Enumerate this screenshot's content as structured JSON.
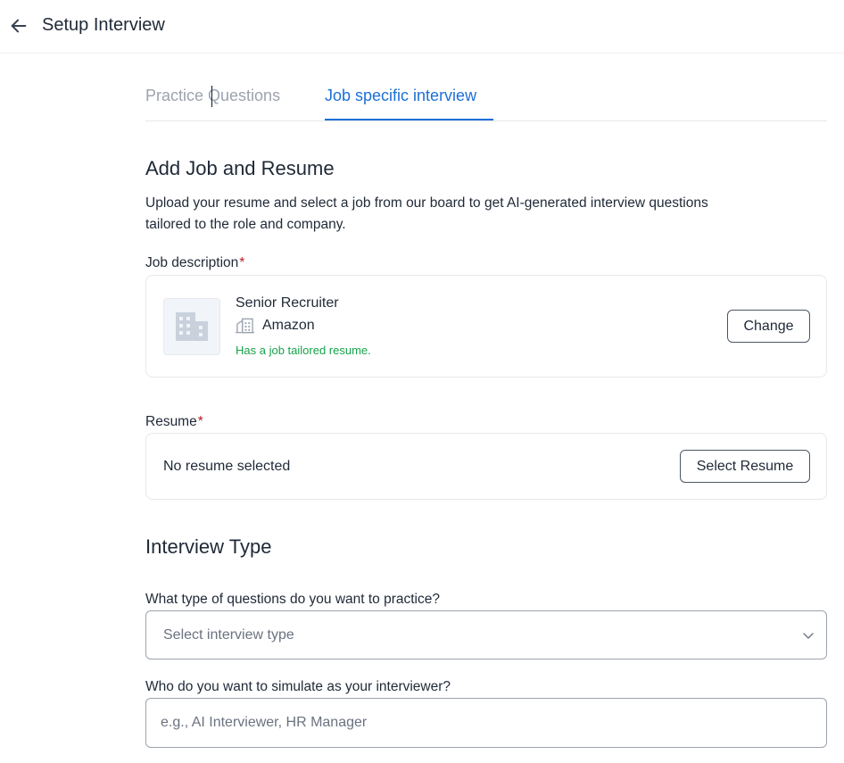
{
  "header": {
    "title": "Setup Interview",
    "back_icon": "arrow-left-icon"
  },
  "tabs": [
    {
      "label": "Practice Questions",
      "active": false
    },
    {
      "label": "Job specific interview",
      "active": true
    }
  ],
  "job_resume": {
    "title": "Add Job and Resume",
    "description": "Upload your resume and select a job from our board to get AI-generated interview questions tailored to the role and company.",
    "job_label": "Job description",
    "required_mark": "*",
    "job": {
      "title": "Senior Recruiter",
      "company": "Amazon",
      "status": "Has a job tailored resume.",
      "change_label": "Change"
    },
    "resume_label": "Resume",
    "resume": {
      "empty_text": "No resume selected",
      "select_label": "Select Resume"
    }
  },
  "interview_type": {
    "title": "Interview Type",
    "question_label": "What type of questions do you want to practice?",
    "select_placeholder": "Select interview type",
    "interviewer_label": "Who do you want to simulate as your interviewer?",
    "interviewer_placeholder": "e.g., AI Interviewer, HR Manager"
  },
  "colors": {
    "accent": "#1d6fd6",
    "success": "#16a34a",
    "required": "#b91c1c"
  }
}
